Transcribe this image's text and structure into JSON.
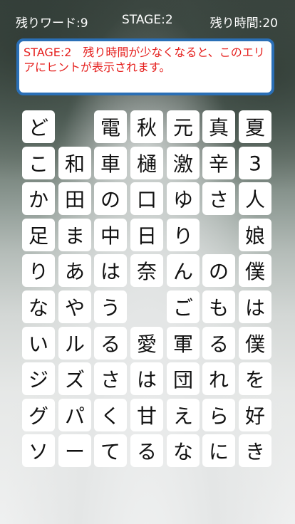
{
  "hud": {
    "remaining_words": "残りワード:9",
    "stage": "STAGE:2",
    "time_left": "残り時間:20"
  },
  "hint": {
    "text": "STAGE:2　残り時間が少なくなると、このエリアにヒントが表示されます。"
  },
  "grid": [
    [
      "ど",
      "",
      "電",
      "秋",
      "元",
      "真",
      "夏"
    ],
    [
      "こ",
      "和",
      "車",
      "樋",
      "激",
      "辛",
      "3"
    ],
    [
      "か",
      "田",
      "の",
      "口",
      "ゆ",
      "さ",
      "人"
    ],
    [
      "足",
      "ま",
      "中",
      "日",
      "り",
      "",
      "娘"
    ],
    [
      "り",
      "あ",
      "は",
      "奈",
      "ん",
      "の",
      "僕"
    ],
    [
      "な",
      "や",
      "う",
      "",
      "ご",
      "も",
      "は"
    ],
    [
      "い",
      "ル",
      "る",
      "愛",
      "軍",
      "る",
      "僕"
    ],
    [
      "ジ",
      "ズ",
      "さ",
      "は",
      "団",
      "れ",
      "を"
    ],
    [
      "グ",
      "パ",
      "く",
      "甘",
      "え",
      "ら",
      "好"
    ],
    [
      "ソ",
      "ー",
      "て",
      "る",
      "な",
      "に",
      "き"
    ]
  ]
}
